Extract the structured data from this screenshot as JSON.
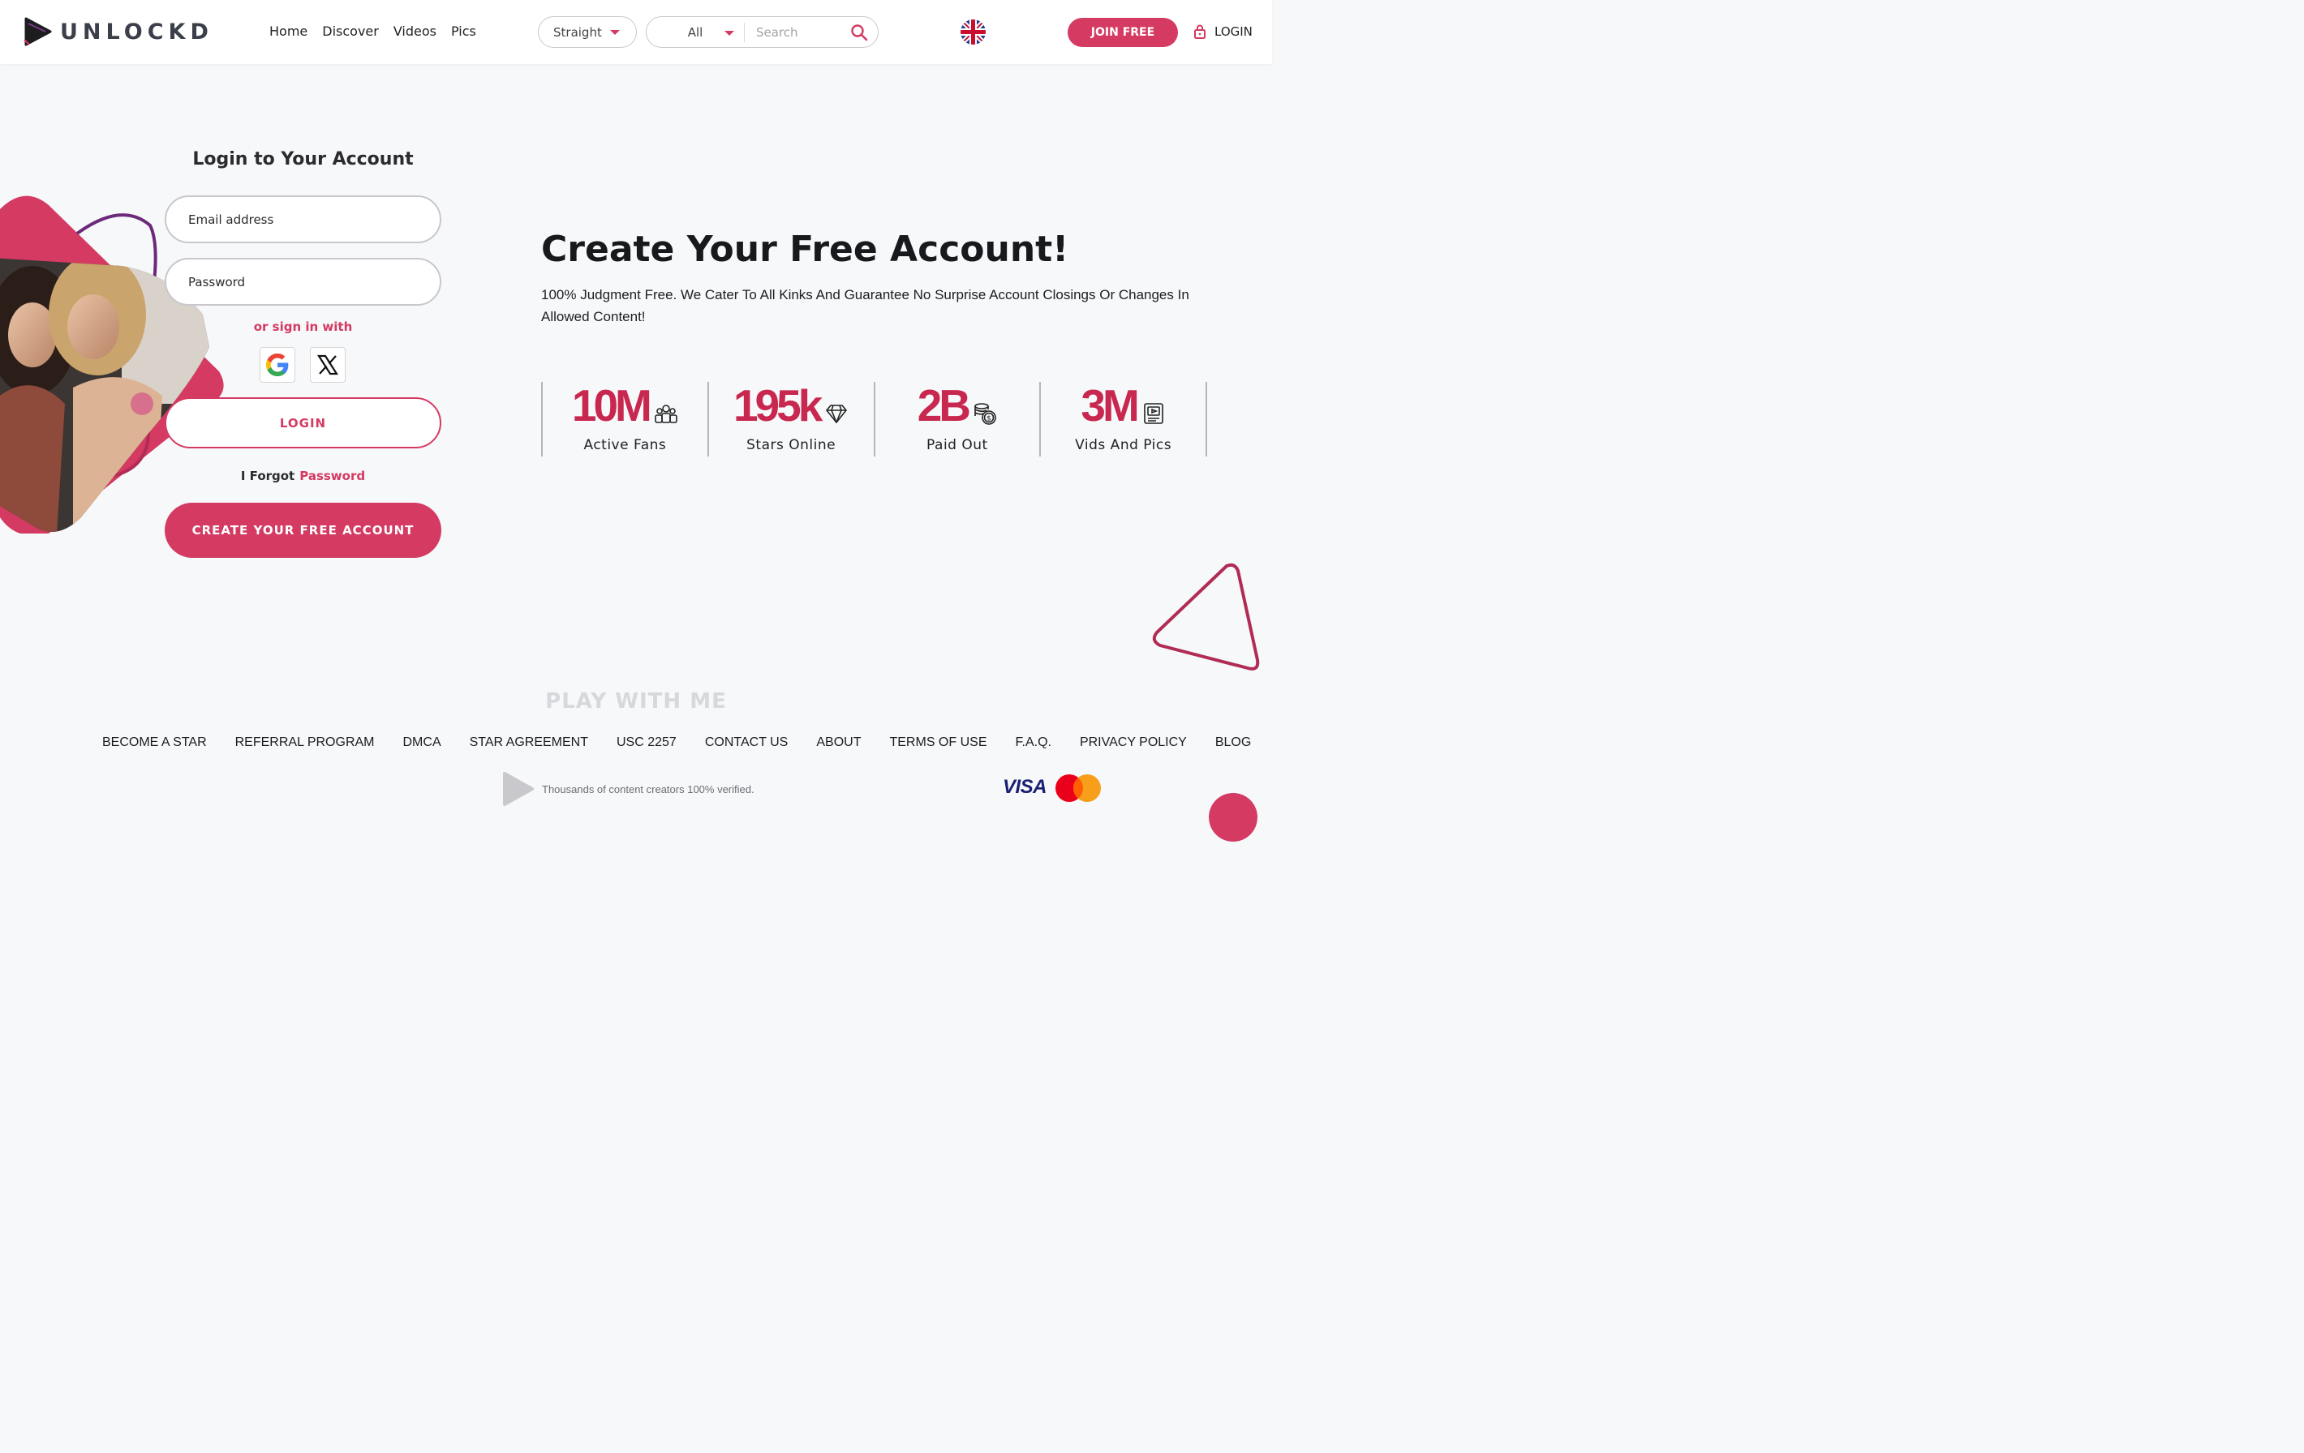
{
  "header": {
    "brand": "UNLOCKD",
    "nav": [
      "Home",
      "Discover",
      "Videos",
      "Pics"
    ],
    "orientation_selected": "Straight",
    "category_selected": "All",
    "search_placeholder": "Search",
    "join_label": "JOIN FREE",
    "login_label": "LOGIN"
  },
  "login_form": {
    "title": "Login to Your Account",
    "email_placeholder": "Email address",
    "password_placeholder": "Password",
    "or_sign_in": "or sign in with",
    "login_button": "LOGIN",
    "forgot_prefix": "I Forgot",
    "forgot_link": "Password",
    "create_button": "CREATE YOUR FREE ACCOUNT"
  },
  "hero": {
    "title_light": "Create Your ",
    "title_bold": "Free Account!",
    "subtitle": "100% Judgment Free. We Cater To All Kinks And Guarantee No Surprise Account Closings Or Changes In Allowed Content!"
  },
  "stats": [
    {
      "value": "10M",
      "label": "Active Fans",
      "icon": "fans-icon"
    },
    {
      "value": "195k",
      "label": "Stars Online",
      "icon": "diamond-icon"
    },
    {
      "value": "2B",
      "label": "Paid Out",
      "icon": "coins-icon"
    },
    {
      "value": "3M",
      "label": "Vids And Pics",
      "icon": "media-icon"
    }
  ],
  "footer": {
    "tagline": "PLAY WITH ME",
    "links": [
      "BECOME A STAR",
      "REFERRAL PROGRAM",
      "DMCA",
      "STAR AGREEMENT",
      "USC 2257",
      "CONTACT US",
      "ABOUT",
      "TERMS OF USE",
      "F.A.Q.",
      "PRIVACY POLICY",
      "BLOG"
    ],
    "verified_text": "Thousands of content creators 100% verified.",
    "visa": "VISA"
  },
  "colors": {
    "accent": "#d43a62",
    "stat_red": "#c8284f",
    "purple": "#6b2a7a"
  }
}
